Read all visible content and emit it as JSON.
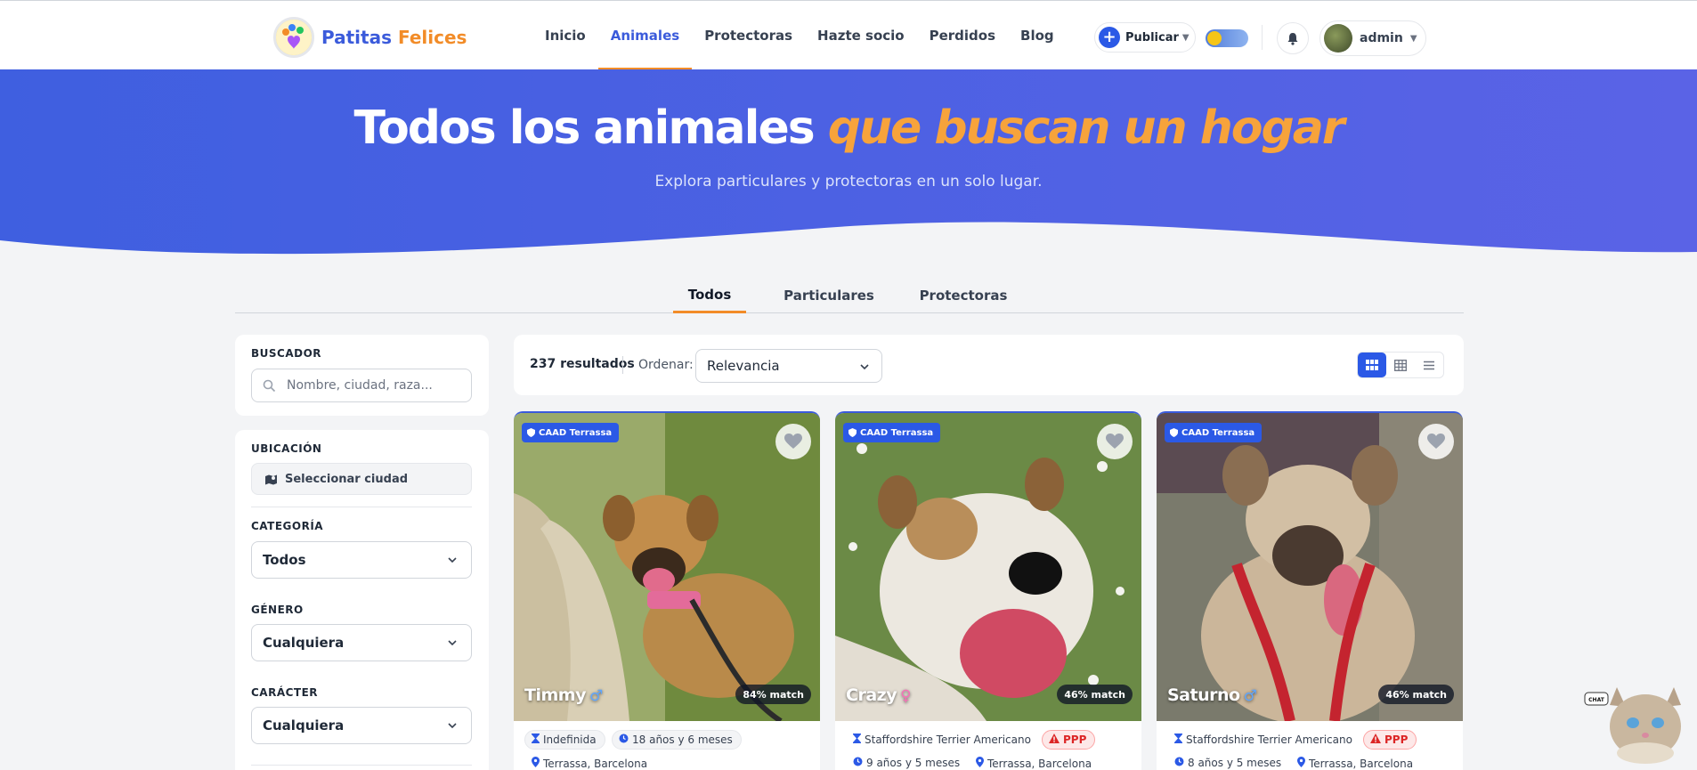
{
  "header": {
    "brand_first": "Patitas",
    "brand_second": "Felices",
    "nav": [
      "Inicio",
      "Animales",
      "Protectoras",
      "Hazte socio",
      "Perdidos",
      "Blog"
    ],
    "nav_active": "Animales",
    "publish_label": "Publicar",
    "user_name": "admin"
  },
  "hero": {
    "title_main": "Todos los animales",
    "title_accent": "que buscan un hogar",
    "subtitle": "Explora particulares y protectoras en un solo lugar."
  },
  "tabs": [
    "Todos",
    "Particulares",
    "Protectoras"
  ],
  "filters": {
    "search_label": "BUSCADOR",
    "search_placeholder": "Nombre, ciudad, raza...",
    "location_label": "UBICACIÓN",
    "location_button": "Seleccionar ciudad",
    "category_label": "CATEGORÍA",
    "category_value": "Todos",
    "gender_label": "GÉNERO",
    "gender_value": "Cualquiera",
    "character_label": "CARÁCTER",
    "character_value": "Cualquiera"
  },
  "results": {
    "count": "237 resultados",
    "sort_label": "Ordenar:",
    "sort_value": "Relevancia"
  },
  "cards": [
    {
      "org": "CAAD Terrassa",
      "name": "Timmy",
      "sex_symbol": "♂",
      "match": "84% match",
      "breed": "Indefinida",
      "age": "18 años y 6 meses",
      "location": "Terrassa, Barcelona"
    },
    {
      "org": "CAAD Terrassa",
      "name": "Crazy",
      "sex_symbol": "♀",
      "match": "46% match",
      "breed": "Staffordshire Terrier Americano",
      "tag": "PPP",
      "age": "9 años y 5 meses",
      "location": "Terrassa, Barcelona"
    },
    {
      "org": "CAAD Terrassa",
      "name": "Saturno",
      "sex_symbol": "♂",
      "match": "46% match",
      "breed": "Staffordshire Terrier Americano",
      "tag": "PPP",
      "age": "8 años y 5 meses",
      "location": "Terrassa, Barcelona"
    }
  ],
  "chat": {
    "bubble": "CHAT"
  },
  "colors": {
    "primary": "#2b59e6",
    "hero": "#4c62e0",
    "accent": "#f28c28",
    "danger": "#dc2626"
  }
}
